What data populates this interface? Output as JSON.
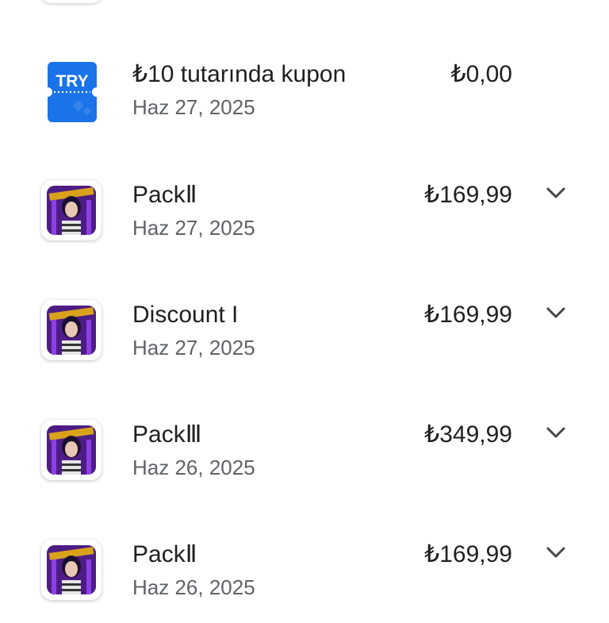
{
  "colors": {
    "text_primary": "#1f1f1f",
    "text_secondary": "#5f6368",
    "coupon_blue": "#1a73e8",
    "game_purple": "#7b2fd0"
  },
  "transactions": [
    {
      "icon": "coupon-ticket-icon",
      "icon_text": "TRY",
      "title": "₺10 tutarında kupon",
      "date": "Haz 27, 2025",
      "price": "₺0,00",
      "expandable": false
    },
    {
      "icon": "game-app-icon",
      "title": "PackⅡ",
      "date": "Haz 27, 2025",
      "price": "₺169,99",
      "expandable": true,
      "chevron_icon": "chevron-down-icon"
    },
    {
      "icon": "game-app-icon",
      "title": "Discount I",
      "date": "Haz 27, 2025",
      "price": "₺169,99",
      "expandable": true,
      "chevron_icon": "chevron-down-icon"
    },
    {
      "icon": "game-app-icon",
      "title": "PackⅢ",
      "date": "Haz 26, 2025",
      "price": "₺349,99",
      "expandable": true,
      "chevron_icon": "chevron-down-icon"
    },
    {
      "icon": "game-app-icon",
      "title": "PackⅡ",
      "date": "Haz 26, 2025",
      "price": "₺169,99",
      "expandable": true,
      "chevron_icon": "chevron-down-icon"
    }
  ]
}
